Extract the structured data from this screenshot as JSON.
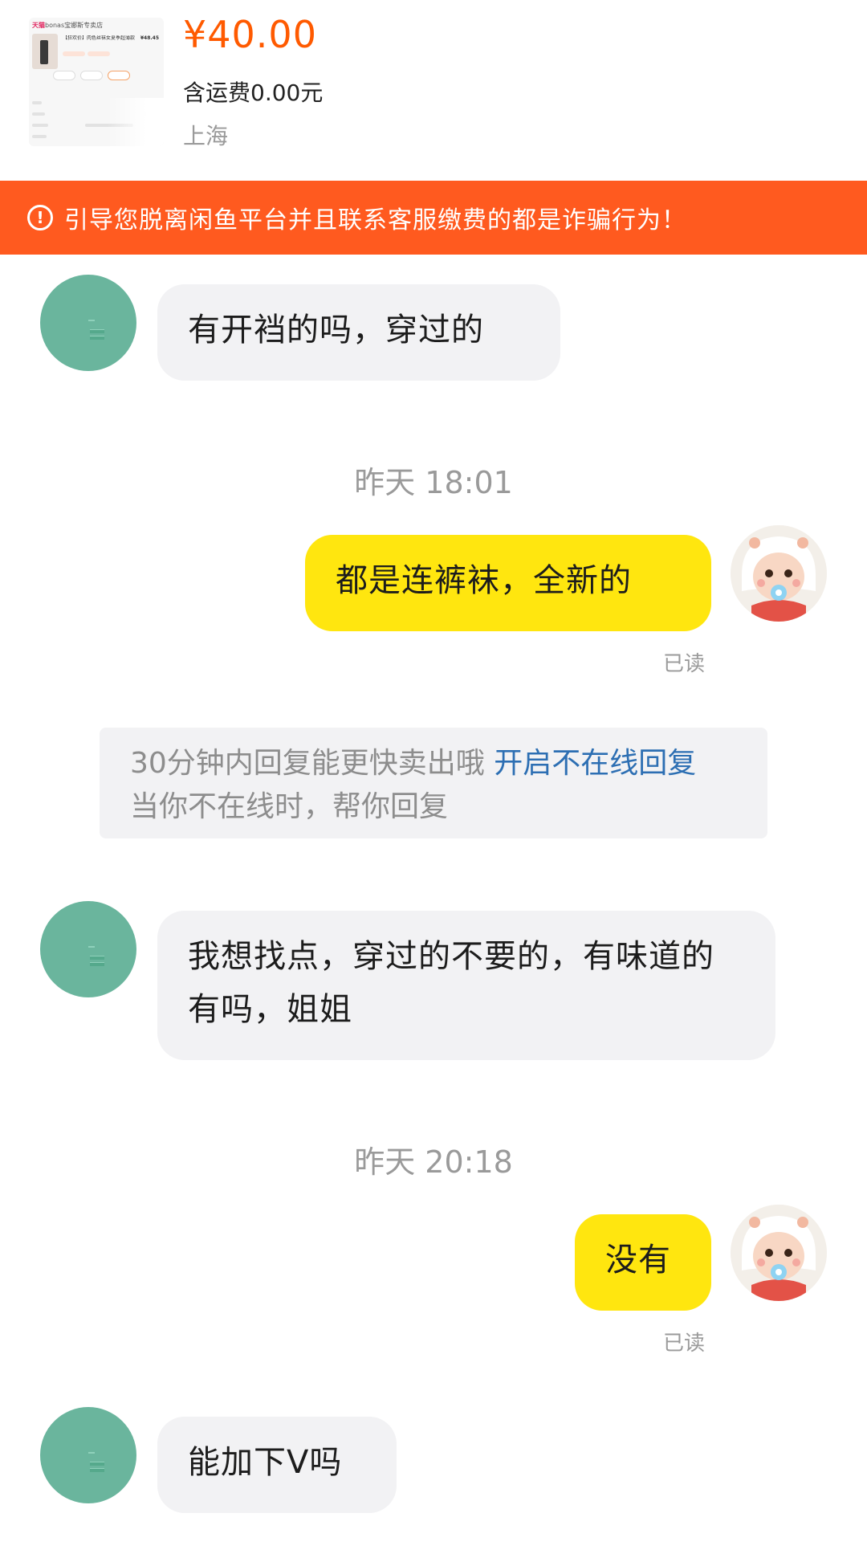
{
  "product": {
    "thumbnail": {
      "shop_tag": "天猫",
      "shop_name": "bonas宝娜斯专卖店",
      "title": "【狂欢价】肉色丝袜女夏季超薄款",
      "price": "¥48.45"
    },
    "price": "¥40.00",
    "shipping": "含运费0.00元",
    "location": "上海"
  },
  "warning": {
    "icon": "alert-circle-icon",
    "text": "引导您脱离闲鱼平台并且联系客服缴费的都是诈骗行为！"
  },
  "messages": [
    {
      "from": "buyer",
      "text": "有开裆的吗，穿过的"
    },
    {
      "timestamp": "昨天 18:01"
    },
    {
      "from": "seller",
      "text": "都是连裤袜，全新的",
      "status": "已读"
    },
    {
      "tip": {
        "text": "30分钟内回复能更快卖出哦",
        "link": "开启不在线回复",
        "sub": "当你不在线时，帮你回复"
      }
    },
    {
      "from": "buyer",
      "text": "我想找点，穿过的不要的，有味道的有吗，姐姐"
    },
    {
      "timestamp": "昨天 20:18"
    },
    {
      "from": "seller",
      "text": "没有",
      "status": "已读"
    },
    {
      "from": "buyer",
      "text": "能加下V吗"
    }
  ],
  "colors": {
    "price": "#ff5a00",
    "warning_bg": "#ff5a1f",
    "buyer_bubble": "#f2f2f4",
    "seller_bubble": "#ffe60f",
    "buyer_avatar": "#6ab59d",
    "link": "#2d6fb3"
  }
}
